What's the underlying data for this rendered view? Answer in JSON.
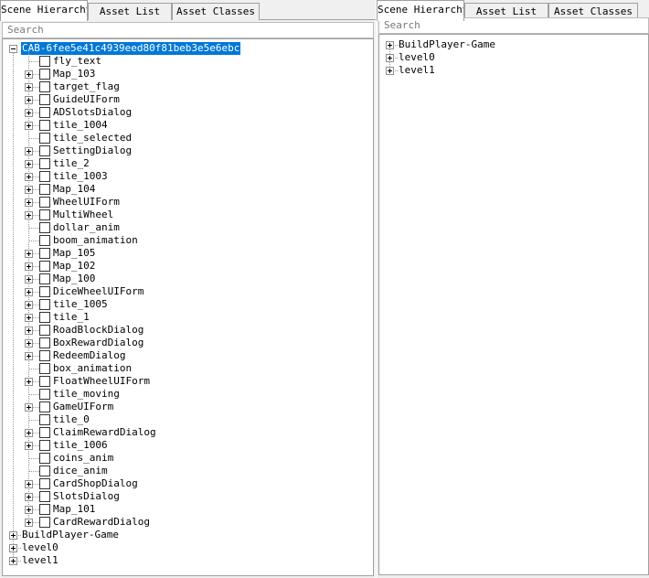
{
  "left_panel": {
    "tabs": [
      {
        "label": "Scene Hierarchy",
        "active": true
      },
      {
        "label": "Asset List",
        "active": false
      },
      {
        "label": "Asset Classes",
        "active": false
      }
    ],
    "search": {
      "placeholder": "Search"
    },
    "tree": {
      "root": {
        "label": "CAB-6fee5e41c4939eed80f81beb3e5e6ebc",
        "expanded": true,
        "selected": true
      },
      "children": [
        {
          "label": "fly_text",
          "has_children": false
        },
        {
          "label": "Map_103",
          "has_children": true
        },
        {
          "label": "target_flag",
          "has_children": true
        },
        {
          "label": "GuideUIForm",
          "has_children": true
        },
        {
          "label": "ADSlotsDialog",
          "has_children": true
        },
        {
          "label": "tile_1004",
          "has_children": true
        },
        {
          "label": "tile_selected",
          "has_children": false
        },
        {
          "label": "SettingDialog",
          "has_children": true
        },
        {
          "label": "tile_2",
          "has_children": true
        },
        {
          "label": "tile_1003",
          "has_children": true
        },
        {
          "label": "Map_104",
          "has_children": true
        },
        {
          "label": "WheelUIForm",
          "has_children": true
        },
        {
          "label": "MultiWheel",
          "has_children": true
        },
        {
          "label": "dollar_anim",
          "has_children": false
        },
        {
          "label": "boom_animation",
          "has_children": false
        },
        {
          "label": "Map_105",
          "has_children": true
        },
        {
          "label": "Map_102",
          "has_children": true
        },
        {
          "label": "Map_100",
          "has_children": true
        },
        {
          "label": "DiceWheelUIForm",
          "has_children": true
        },
        {
          "label": "tile_1005",
          "has_children": true
        },
        {
          "label": "tile_1",
          "has_children": true
        },
        {
          "label": "RoadBlockDialog",
          "has_children": true
        },
        {
          "label": "BoxRewardDialog",
          "has_children": true
        },
        {
          "label": "RedeemDialog",
          "has_children": true
        },
        {
          "label": "box_animation",
          "has_children": false
        },
        {
          "label": "FloatWheelUIForm",
          "has_children": true
        },
        {
          "label": "tile_moving",
          "has_children": false
        },
        {
          "label": "GameUIForm",
          "has_children": true
        },
        {
          "label": "tile_0",
          "has_children": false
        },
        {
          "label": "ClaimRewardDialog",
          "has_children": true
        },
        {
          "label": "tile_1006",
          "has_children": true
        },
        {
          "label": "coins_anim",
          "has_children": false
        },
        {
          "label": "dice_anim",
          "has_children": false
        },
        {
          "label": "CardShopDialog",
          "has_children": true
        },
        {
          "label": "SlotsDialog",
          "has_children": true
        },
        {
          "label": "Map_101",
          "has_children": true
        },
        {
          "label": "CardRewardDialog",
          "has_children": true
        }
      ],
      "siblings": [
        {
          "label": "BuildPlayer-Game"
        },
        {
          "label": "level0"
        },
        {
          "label": "level1"
        }
      ]
    }
  },
  "right_panel": {
    "tabs": [
      {
        "label": "Scene Hierarchy",
        "active": true
      },
      {
        "label": "Asset List",
        "active": false
      },
      {
        "label": "Asset Classes",
        "active": false
      }
    ],
    "search": {
      "placeholder": "Search"
    },
    "tree": {
      "items": [
        {
          "label": "BuildPlayer-Game"
        },
        {
          "label": "level0"
        },
        {
          "label": "level1"
        }
      ]
    }
  },
  "colors": {
    "selection": "#0078d7",
    "panel_bg": "#f0f0f0"
  }
}
